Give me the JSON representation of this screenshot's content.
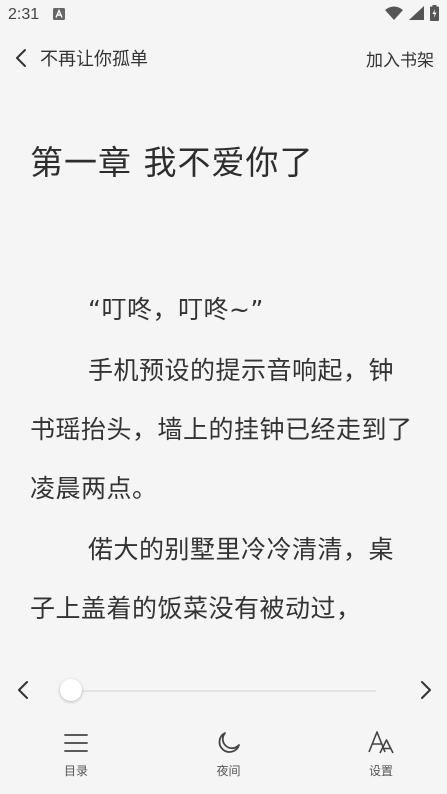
{
  "status_bar": {
    "time": "2:31",
    "notification_icon": "font-download-icon",
    "icons": [
      "wifi-icon",
      "signal-icon",
      "battery-icon"
    ]
  },
  "header": {
    "back_icon": "chevron-left-icon",
    "book_title": "不再让你孤单",
    "add_shelf_label": "加入书架"
  },
  "content": {
    "chapter_title": "第一章 我不爱你了",
    "paragraphs": [
      "“叮咚，叮咚~”",
      "手机预设的提示音响起，钟书瑶抬头，墙上的挂钟已经走到了凌晨两点。",
      "偌大的别墅里冷冷清清，桌子上盖着的饭菜没有被动过，"
    ]
  },
  "progress": {
    "prev_icon": "chevron-left-icon",
    "next_icon": "chevron-right-icon",
    "value": 0.03
  },
  "toolbar": {
    "items": [
      {
        "icon": "list-icon",
        "label": "目录"
      },
      {
        "icon": "moon-icon",
        "label": "夜间"
      },
      {
        "icon": "font-settings-icon",
        "label": "设置"
      }
    ]
  },
  "colors": {
    "background": "#f5f5f5",
    "text": "#333333",
    "track": "#e3e3e3"
  }
}
